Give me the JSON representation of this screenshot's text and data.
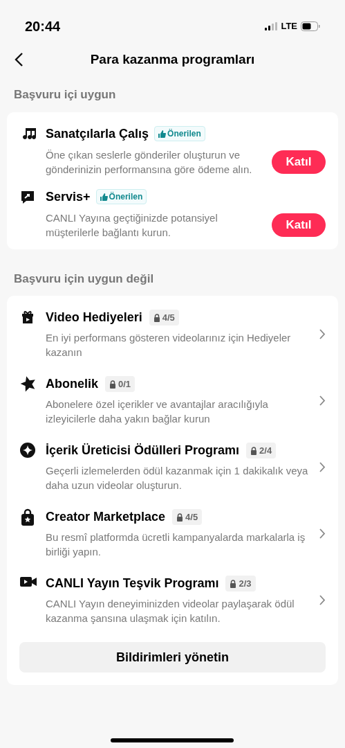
{
  "status_bar": {
    "time": "20:44",
    "network": "LTE"
  },
  "header": {
    "title": "Para kazanma programları"
  },
  "eligible": {
    "heading": "Başvuru içi uygun",
    "items": [
      {
        "title": "Sanatçılarla Çalış",
        "badge": "Önerilen",
        "description": "Öne çıkan seslerle gönderiler oluşturun ve gönderinizin performansına göre ödeme alın.",
        "button": "Katıl"
      },
      {
        "title": "Servis+",
        "badge": "Önerilen",
        "description": "CANLI Yayına geçtiğinizde potansiyel müşterilerle bağlantı kurun.",
        "button": "Katıl"
      }
    ]
  },
  "ineligible": {
    "heading": "Başvuru için uygun değil",
    "items": [
      {
        "title": "Video Hediyeleri",
        "progress": "4/5",
        "description": "En iyi performans gösteren videolarınız için Hediyeler kazanın"
      },
      {
        "title": "Abonelik",
        "progress": "0/1",
        "description": "Abonelere özel içerikler ve avantajlar aracılığıyla izleyicilerle daha yakın bağlar kurun"
      },
      {
        "title": "İçerik Üreticisi Ödülleri Programı",
        "progress": "2/4",
        "description": "Geçerli izlemelerden ödül kazanmak için 1 dakikalık veya daha uzun videolar oluşturun."
      },
      {
        "title": "Creator Marketplace",
        "progress": "4/5",
        "description": "Bu resmî platformda ücretli kampanyalarda markalarla iş birliği yapın."
      },
      {
        "title": "CANLI Yayın Teşvik Programı",
        "progress": "2/3",
        "description": "CANLI Yayın deneyiminizden videolar paylaşarak ödül kazanma şansına ulaşmak için katılın."
      }
    ],
    "footer_button": "Bildirimleri yönetin"
  }
}
